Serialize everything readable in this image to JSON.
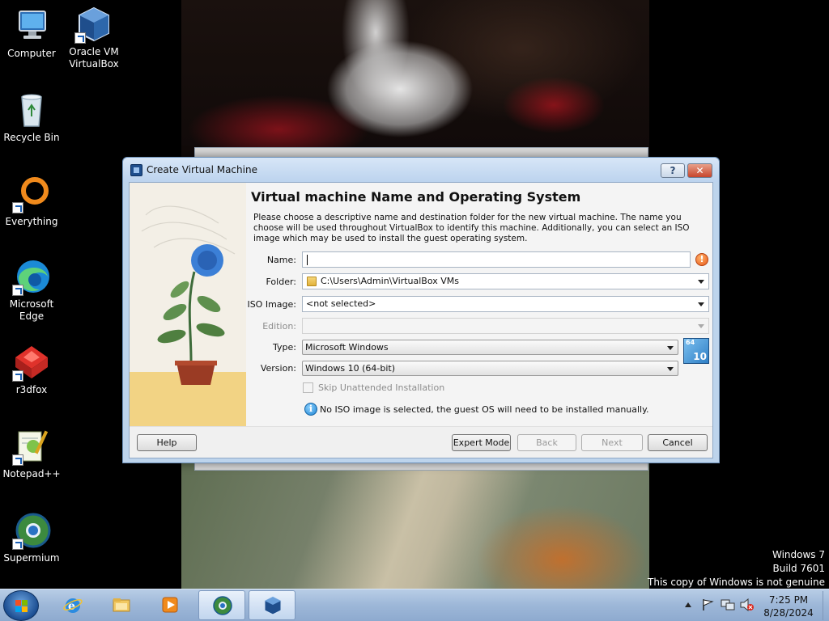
{
  "desktop": {
    "icons": [
      {
        "label": "Computer"
      },
      {
        "label": "Oracle VM\nVirtualBox"
      },
      {
        "label": "Recycle Bin"
      },
      {
        "label": "Everything"
      },
      {
        "label": "Microsoft\nEdge"
      },
      {
        "label": "r3dfox"
      },
      {
        "label": "Notepad++"
      },
      {
        "label": "Supermium"
      }
    ]
  },
  "dialog": {
    "title": "Create Virtual Machine",
    "help_glyph": "?",
    "close_glyph": "✕",
    "heading": "Virtual machine Name and Operating System",
    "description": "Please choose a descriptive name and destination folder for the new virtual machine. The name you choose will be used throughout VirtualBox to identify this machine. Additionally, you can select an ISO image which may be used to install the guest operating system.",
    "form": {
      "name_label": "Name:",
      "name_value": "",
      "folder_label": "Folder:",
      "folder_value": "C:\\Users\\Admin\\VirtualBox VMs",
      "iso_label": "ISO Image:",
      "iso_value": "<not selected>",
      "edition_label": "Edition:",
      "edition_value": "",
      "type_label": "Type:",
      "type_value": "Microsoft Windows",
      "version_label": "Version:",
      "version_value": "Windows 10 (64-bit)",
      "os_badge_bits": "64",
      "os_badge_version": "10",
      "skip_unattended_label": "Skip Unattended Installation",
      "skip_unattended_checked": false,
      "info_message": "No ISO image is selected, the guest OS will need to be installed manually."
    },
    "buttons": {
      "help": "Help",
      "expert_mode": "Expert Mode",
      "back": "Back",
      "next": "Next",
      "cancel": "Cancel"
    }
  },
  "watermark": {
    "line1": "Windows 7",
    "line2": "Build 7601",
    "line3": "This copy of Windows is not genuine"
  },
  "taskbar": {
    "pinned": [
      "internet-explorer-icon",
      "windows-explorer-icon",
      "media-player-icon",
      "supermium-icon",
      "virtualbox-icon"
    ],
    "clock_time": "7:25 PM",
    "clock_date": "8/28/2024"
  },
  "colors": {
    "titlebar": "#bcd3ee",
    "taskbar": "#9db7d8",
    "warning": "#e8581a",
    "info": "#1d83d2"
  }
}
